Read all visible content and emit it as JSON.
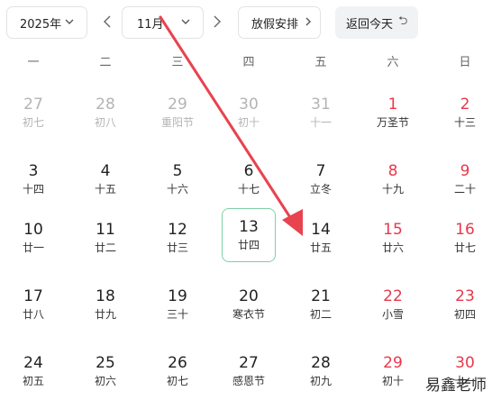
{
  "toolbar": {
    "year": "2025年",
    "month": "11月",
    "holiday_label": "放假安排",
    "today_button": "返回今天",
    "prev_month_icon": "chevron-left-icon",
    "next_month_icon": "chevron-right-icon"
  },
  "weekdays": [
    "一",
    "二",
    "三",
    "四",
    "五",
    "六",
    "日"
  ],
  "rows": [
    [
      {
        "d": "27",
        "l": "初七",
        "other": true
      },
      {
        "d": "28",
        "l": "初八",
        "other": true
      },
      {
        "d": "29",
        "l": "重阳节",
        "other": true
      },
      {
        "d": "30",
        "l": "初十",
        "other": true
      },
      {
        "d": "31",
        "l": "十一",
        "other": true
      },
      {
        "d": "1",
        "l": "万圣节",
        "holiday": true
      },
      {
        "d": "2",
        "l": "十三",
        "holiday": true
      }
    ],
    [
      {
        "d": "3",
        "l": "十四"
      },
      {
        "d": "4",
        "l": "十五"
      },
      {
        "d": "5",
        "l": "十六"
      },
      {
        "d": "6",
        "l": "十七"
      },
      {
        "d": "7",
        "l": "立冬"
      },
      {
        "d": "8",
        "l": "十九",
        "holiday": true
      },
      {
        "d": "9",
        "l": "二十",
        "holiday": true
      }
    ],
    [
      {
        "d": "10",
        "l": "廿一"
      },
      {
        "d": "11",
        "l": "廿二"
      },
      {
        "d": "12",
        "l": "廿三"
      },
      {
        "d": "13",
        "l": "廿四",
        "today": true
      },
      {
        "d": "14",
        "l": "廿五"
      },
      {
        "d": "15",
        "l": "廿六",
        "holiday": true
      },
      {
        "d": "16",
        "l": "廿七",
        "holiday": true
      }
    ],
    [
      {
        "d": "17",
        "l": "廿八"
      },
      {
        "d": "18",
        "l": "廿九"
      },
      {
        "d": "19",
        "l": "三十"
      },
      {
        "d": "20",
        "l": "寒衣节"
      },
      {
        "d": "21",
        "l": "初二"
      },
      {
        "d": "22",
        "l": "小雪",
        "holiday": true
      },
      {
        "d": "23",
        "l": "初四",
        "holiday": true
      }
    ],
    [
      {
        "d": "24",
        "l": "初五"
      },
      {
        "d": "25",
        "l": "初六"
      },
      {
        "d": "26",
        "l": "初七"
      },
      {
        "d": "27",
        "l": "感恩节"
      },
      {
        "d": "28",
        "l": "初九"
      },
      {
        "d": "29",
        "l": "初十",
        "holiday": true
      },
      {
        "d": "30",
        "l": "十一",
        "holiday": true
      }
    ]
  ],
  "watermark": "易鑫老师",
  "colors": {
    "holiday": "#e8384b",
    "today_border": "#7fd0a6",
    "arrow": "#e8434f",
    "muted": "#b4b4b4"
  }
}
